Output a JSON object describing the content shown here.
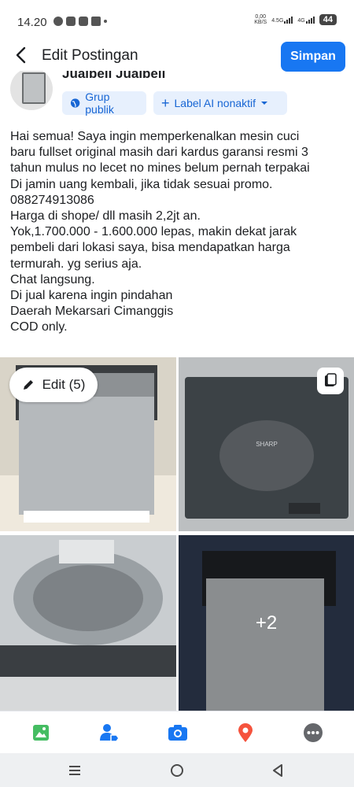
{
  "status_bar": {
    "time": "14.20",
    "net_speed_value": "0,00",
    "net_speed_unit": "KB/S",
    "sim1": "4.5G",
    "sim2": "4G",
    "battery": "44"
  },
  "header": {
    "title": "Edit Postingan",
    "save_label": "Simpan"
  },
  "author": {
    "name": "Jualbeli Jualbeli",
    "audience_chip": "Grup publik",
    "ai_label_chip": "Label AI nonaktif"
  },
  "post_lines": [
    "Hai semua! Saya ingin memperkenalkan mesin cuci",
    "baru fullset original masih dari kardus garansi resmi 3",
    "tahun mulus no lecet no mines belum pernah terpakai",
    "Di jamin uang kembali, jika tidak sesuai promo.",
    "088274913086",
    "Harga di shope/ dll masih 2,2jt an.",
    "Yok,1.700.000 - 1.600.000 lepas, makin dekat jarak",
    "pembeli dari lokasi saya, bisa mendapatkan harga",
    "termurah. yg serius aja.",
    "Chat langsung.",
    "Di jual karena ingin pindahan",
    "Daerah Mekarsari Cimanggis",
    "COD only."
  ],
  "photos": {
    "edit_label": "Edit (5)",
    "more_count": "+2",
    "brand_text": "SHARP"
  },
  "toolbar_icons": [
    "photo-icon",
    "tag-people-icon",
    "camera-icon",
    "location-icon",
    "more-icon"
  ],
  "colors": {
    "accent": "#1877f2",
    "chip_bg": "#e7f0fd",
    "photo_green": "#45bd62",
    "location_red": "#f5533d",
    "tag_blue": "#1877f2"
  }
}
